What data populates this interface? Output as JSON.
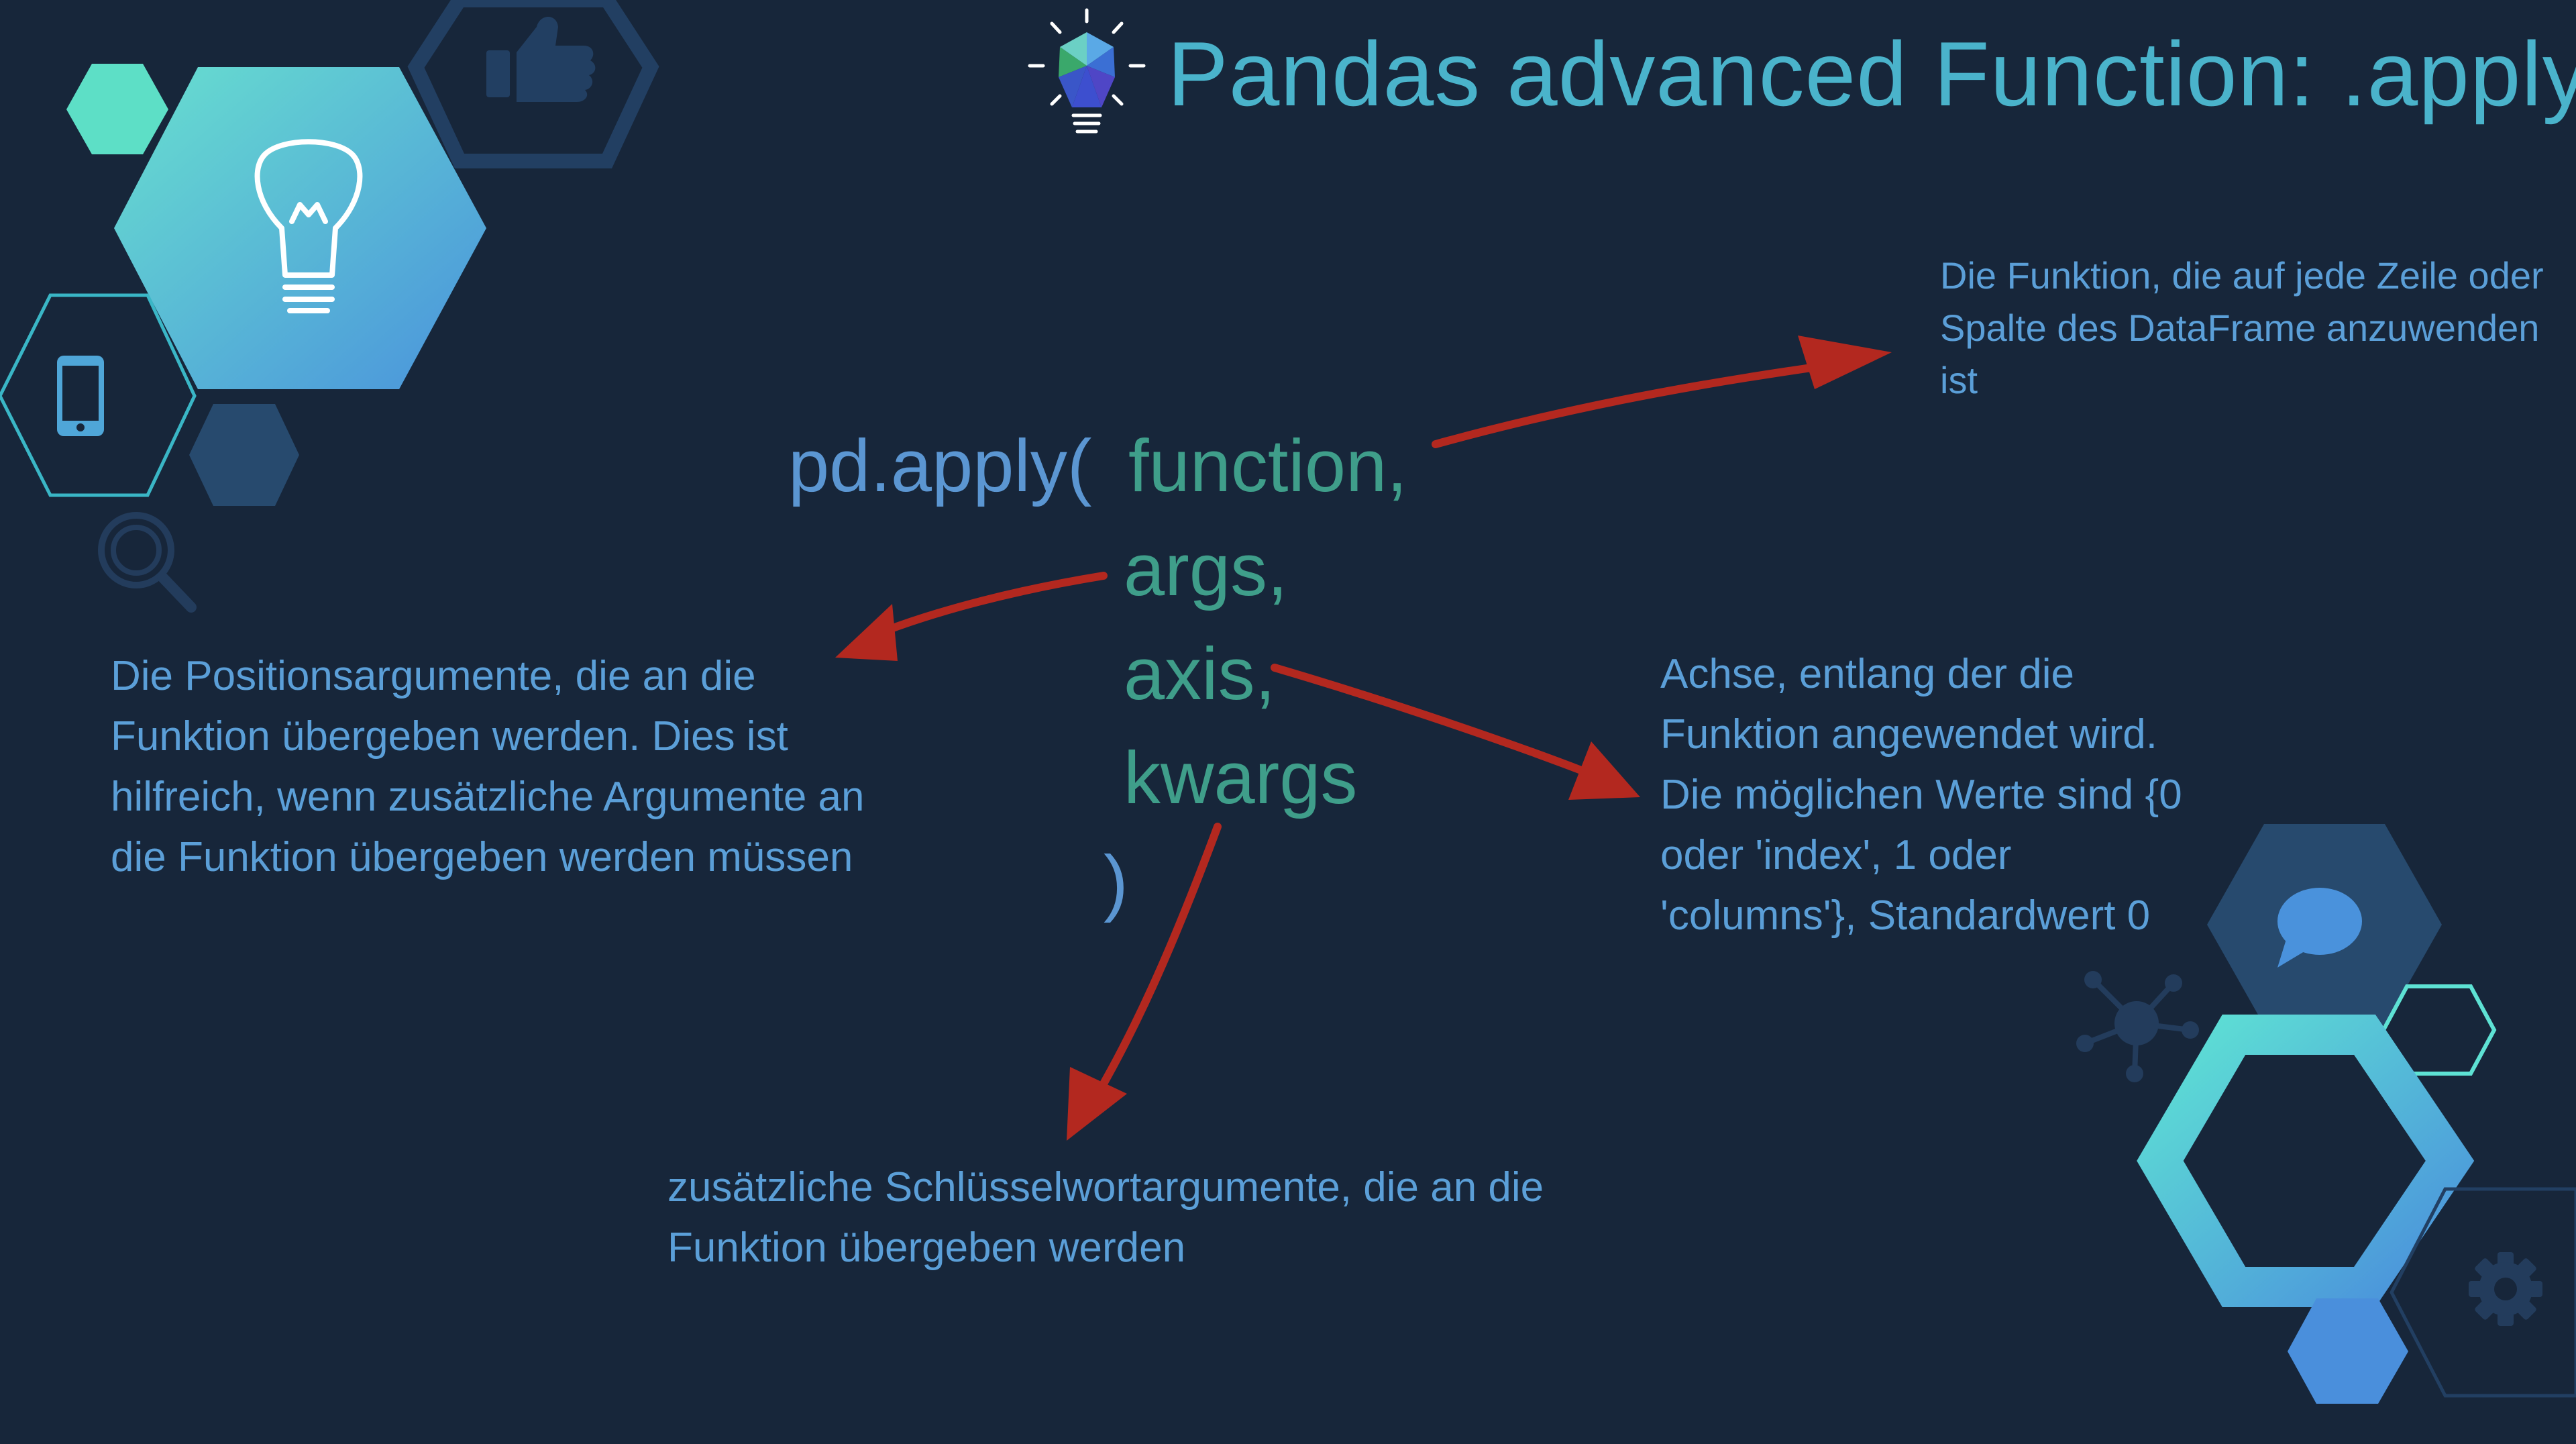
{
  "slide": {
    "title": "Pandas advanced Function: .apply",
    "colors": {
      "background": "#17263a",
      "title": "#4ab3cb",
      "code_function": "#5b96d2",
      "code_params": "#3f9e8a",
      "notes": "#5b9fd8",
      "arrows": "#b3281f"
    }
  },
  "code": {
    "call": "pd.apply(",
    "params": [
      "function,",
      "args,",
      "axis,",
      "kwargs"
    ],
    "close": ")"
  },
  "notes": {
    "function": "Die Funktion, die auf jede Zeile oder Spalte des DataFrame anzuwenden ist",
    "args": "Die Positionsargumente, die an die Funktion übergeben werden. Dies ist hilfreich, wenn zusätzliche Argumente an die Funktion übergeben werden müssen",
    "axis": "Achse, entlang der die Funktion angewendet wird. Die möglichen Werte sind {0 oder 'index', 1 oder 'columns'}, Standardwert 0",
    "kwargs": "zusätzliche Schlüsselwortargumente, die an die Funktion übergeben werden"
  },
  "icons": [
    "lightbulb-icon",
    "thumbs-up-icon",
    "smartphone-icon",
    "magnifier-icon",
    "chat-bubble-icon",
    "network-icon",
    "gear-icon",
    "title-lightbulb-icon"
  ]
}
